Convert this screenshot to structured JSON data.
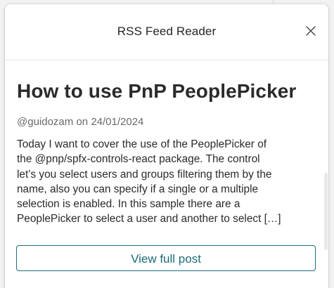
{
  "panel": {
    "title": "RSS Feed Reader",
    "close_icon": "close-icon"
  },
  "post": {
    "title": "How to use PnP PeoplePicker",
    "author": "@guidozam",
    "date_prefix": "on",
    "date": "24/01/2024",
    "excerpt_lines": [
      "Today I want to cover the use of the PeoplePicker of",
      "the @pnp/spfx-controls-react package. The control",
      "let’s you select users and groups filtering them by the",
      "name, also you can specify if a single or a multiple",
      "selection is enabled. In this sample there are a",
      "PeoplePicker to select a user and another to select […]"
    ],
    "button_label": "View full post"
  },
  "colors": {
    "accent": "#1d6b75",
    "text": "#2b2b2b",
    "meta": "#6a6a6a"
  }
}
